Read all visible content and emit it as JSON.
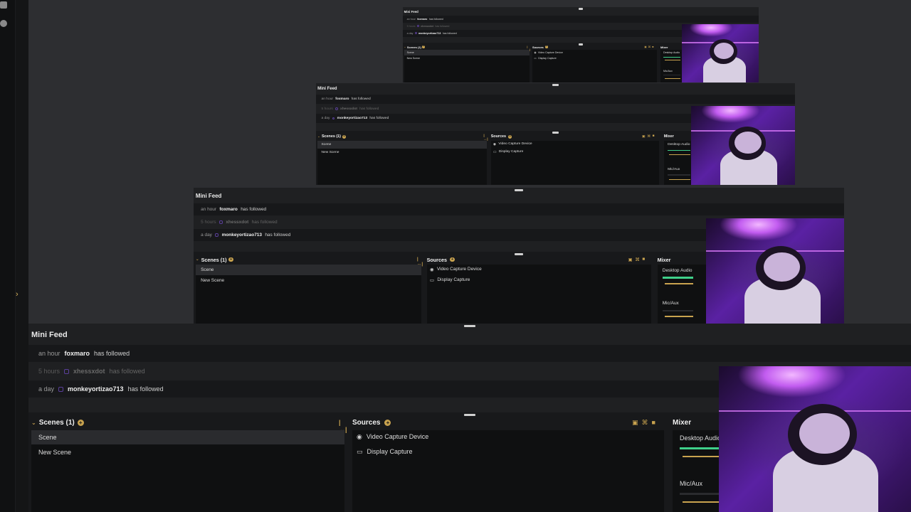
{
  "mini_feed": {
    "title": "Mini Feed",
    "rows": [
      {
        "time": "an hour",
        "user": "foxmaro",
        "action": "has followed"
      },
      {
        "time": "5 hours",
        "user": "xhessxdot",
        "action": "has followed"
      },
      {
        "time": "a day",
        "user": "monkeyortizao713",
        "action": "has followed"
      }
    ]
  },
  "scenes": {
    "title": "Scenes (1)",
    "items": [
      "Scene",
      "New Scene"
    ]
  },
  "sources": {
    "title": "Sources",
    "items": [
      "Video Capture Device",
      "Display Capture"
    ]
  },
  "mixer": {
    "title": "Mixer",
    "channels": [
      "Desktop Audio",
      "Mic/Aux"
    ]
  },
  "icons": {
    "chevron": "chevron-right-icon",
    "add": "plus-circle-icon",
    "webcam": "webcam-icon",
    "monitor": "monitor-icon",
    "twitch": "twitch-icon"
  },
  "colors": {
    "accent": "#c9a34f",
    "meter_green": "#3fd08a",
    "meter_gold": "#c9a34f",
    "webcam_purple": "#7a2fd0"
  }
}
